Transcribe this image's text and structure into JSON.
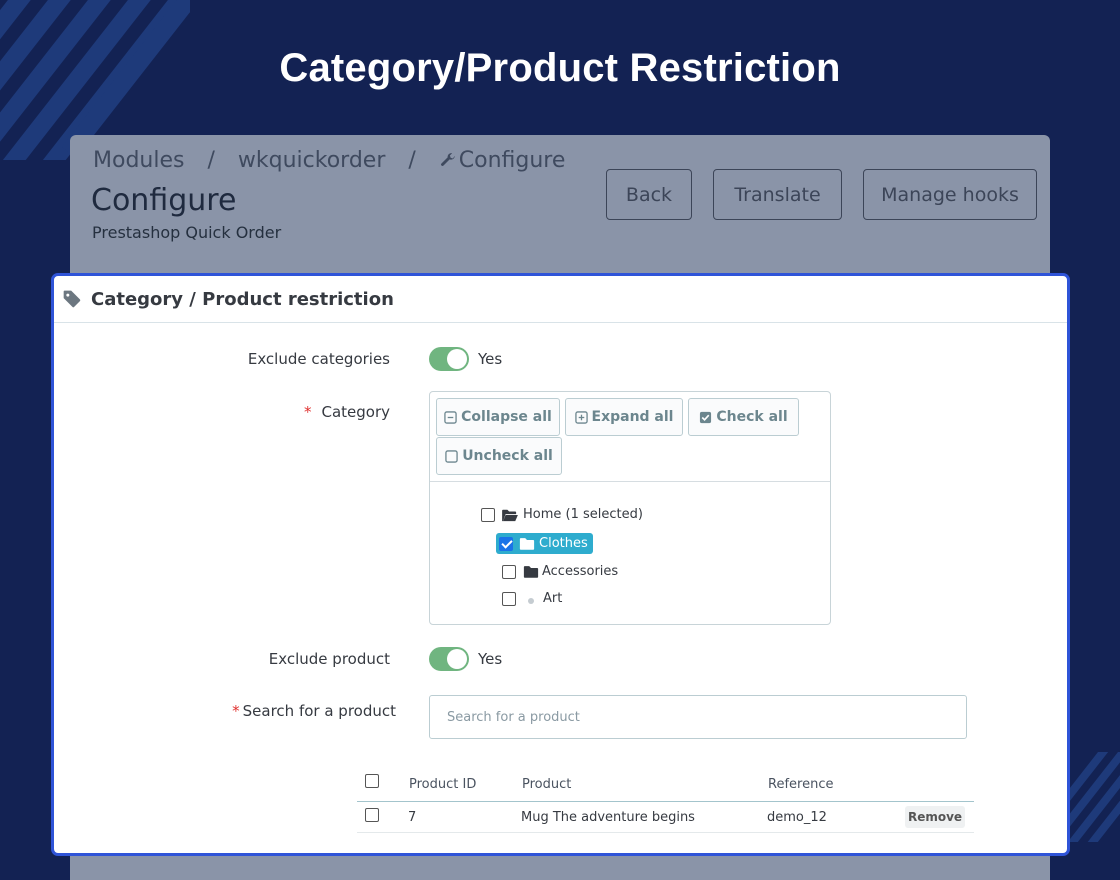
{
  "hero": {
    "title": "Category/Product Restriction"
  },
  "colors": {
    "background": "#132253",
    "panel_border": "#2f54d8",
    "toggle_on": "#70b580",
    "highlight": "#2eacce",
    "required": "#e0312f"
  },
  "admin": {
    "breadcrumb": [
      "Modules",
      "/",
      "wkquickorder",
      "/",
      "Configure"
    ],
    "title": "Configure",
    "subtitle": "Prestashop Quick Order",
    "buttons": {
      "back": "Back",
      "translate": "Translate",
      "manage_hooks": "Manage hooks"
    }
  },
  "panel": {
    "heading": "Category / Product restriction",
    "heading_icon": "tag-icon",
    "exclude_categories": {
      "label": "Exclude categories",
      "state": "Yes",
      "enabled": true
    },
    "category": {
      "required_mark": "*",
      "label": "Category",
      "buttons": {
        "collapse_all": "Collapse all",
        "expand_all": "Expand all",
        "check_all": "Check all",
        "uncheck_all": "Uncheck all"
      },
      "tree": [
        {
          "label": "Home (1 selected)",
          "icon": "folder-open-icon",
          "checked": false
        },
        {
          "label": "Clothes",
          "icon": "folder-icon",
          "checked": true
        },
        {
          "label": "Accessories",
          "icon": "folder-icon",
          "checked": false
        },
        {
          "label": "Art",
          "icon": "dot-icon",
          "checked": false
        }
      ]
    },
    "exclude_product": {
      "label": "Exclude product",
      "state": "Yes",
      "enabled": true
    },
    "search": {
      "required_mark": "*",
      "label": "Search for a product",
      "placeholder": "Search for a product"
    },
    "table": {
      "headers": {
        "product_id": "Product ID",
        "product": "Product",
        "reference": "Reference"
      },
      "rows": [
        {
          "product_id": "7",
          "product": "Mug The adventure begins",
          "reference": "demo_12",
          "action": "Remove"
        }
      ]
    }
  }
}
